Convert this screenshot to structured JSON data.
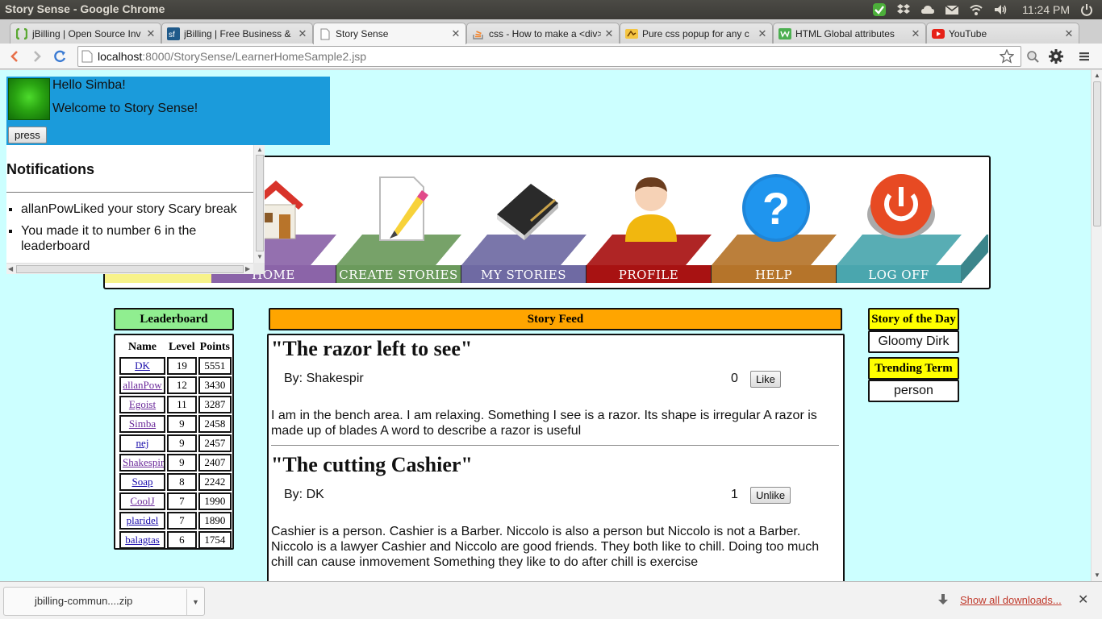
{
  "window": {
    "title": "Story Sense - Google Chrome"
  },
  "tray": {
    "clock": "11:24 PM",
    "icons": [
      "check-icon",
      "dropbox-icon",
      "cloud-icon",
      "mail-icon",
      "wifi-icon",
      "volume-icon",
      "power-icon"
    ]
  },
  "tabs": [
    {
      "label": "jBilling | Open Source Inv",
      "icon": "jbilling-icon"
    },
    {
      "label": "jBilling | Free Business &",
      "icon": "sourceforge-icon"
    },
    {
      "label": "Story Sense",
      "icon": "page-icon",
      "active": true
    },
    {
      "label": "css - How to make a <div>",
      "icon": "stackoverflow-icon"
    },
    {
      "label": "Pure css popup for any c",
      "icon": "popup-site-icon"
    },
    {
      "label": "HTML Global attributes",
      "icon": "w3schools-icon"
    },
    {
      "label": "YouTube",
      "icon": "youtube-icon"
    }
  ],
  "omnibox": {
    "host": "localhost",
    "path": ":8000/StorySense/LearnerHomeSample2.jsp"
  },
  "header": {
    "greeting": "Hello Simba!",
    "welcome": "Welcome to Story Sense!",
    "press_label": "press"
  },
  "notifications": {
    "title": "Notifications",
    "items": [
      "allanPowLiked your story Scary break",
      "You made it to number 6 in the leaderboard"
    ]
  },
  "nav": {
    "items": [
      {
        "label": "HOME",
        "icon": "house-icon"
      },
      {
        "label": "CREATE STORIES",
        "icon": "pencil-paper-icon"
      },
      {
        "label": "MY STORIES",
        "icon": "book-icon"
      },
      {
        "label": "PROFILE",
        "icon": "user-icon"
      },
      {
        "label": "HELP",
        "icon": "help-icon"
      },
      {
        "label": "LOG OFF",
        "icon": "power-button-icon"
      }
    ],
    "colors": [
      "#f7f28a",
      "#8b64a8",
      "#6b9a5c",
      "#6f6aa3",
      "#a81212",
      "#b5742a",
      "#4aa6ae"
    ]
  },
  "leaderboard": {
    "title": "Leaderboard",
    "headers": [
      "Name",
      "Level",
      "Points"
    ],
    "rows": [
      {
        "name": "DK",
        "level": "19",
        "points": "5551"
      },
      {
        "name": "allanPow",
        "level": "12",
        "points": "3430"
      },
      {
        "name": "Egoist",
        "level": "11",
        "points": "3287"
      },
      {
        "name": "Simba",
        "level": "9",
        "points": "2458"
      },
      {
        "name": "nej",
        "level": "9",
        "points": "2457"
      },
      {
        "name": "Shakespir",
        "level": "9",
        "points": "2407"
      },
      {
        "name": "Soap",
        "level": "8",
        "points": "2242"
      },
      {
        "name": "CoolJ",
        "level": "7",
        "points": "1990"
      },
      {
        "name": "plaridel",
        "level": "7",
        "points": "1890"
      },
      {
        "name": "balagtas",
        "level": "6",
        "points": "1754"
      }
    ]
  },
  "feed": {
    "title": "Story Feed",
    "stories": [
      {
        "title": "\"The razor left to see\"",
        "author": "By: Shakespir",
        "likes": "0",
        "button": "Like",
        "body": "I am in the bench area. I am relaxing. Something I see is a razor. Its shape is irregular A razor is made up of blades A word to describe a razor is useful"
      },
      {
        "title": "\"The cutting Cashier\"",
        "author": "By: DK",
        "likes": "1",
        "button": "Unlike",
        "body": "Cashier is a person. Cashier is a Barber. Niccolo is also a person but Niccolo is not a Barber. Niccolo is a lawyer Cashier and Niccolo are good friends. They both like to chill. Doing too much chill can cause inmovement Something they like to do after chill is exercise"
      }
    ]
  },
  "sidebar": {
    "story_of_day_title": "Story of the Day",
    "story_of_day_value": "Gloomy Dirk",
    "trending_title": "Trending Term",
    "trending_value": "person"
  },
  "downloads": {
    "file": "jbilling-commun....zip",
    "show_all": "Show all downloads..."
  }
}
